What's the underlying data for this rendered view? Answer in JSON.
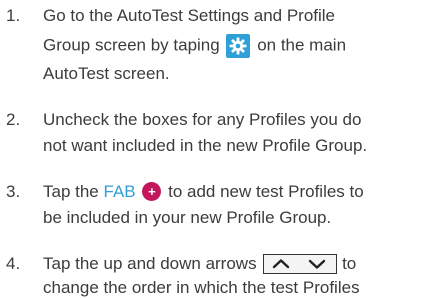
{
  "steps": [
    {
      "number": "1.",
      "lines": [
        "Go to the AutoTest Settings and Profile",
        "Group screen by taping",
        "on the main",
        "AutoTest screen."
      ]
    },
    {
      "number": "2.",
      "lines": [
        "Uncheck the boxes for any Profiles you do",
        "not want included in the new Profile Group."
      ]
    },
    {
      "number": "3.",
      "lines": [
        "Tap the",
        "FAB",
        "to add new test Profiles to",
        "be included in your new Profile Group."
      ]
    },
    {
      "number": "4.",
      "lines": [
        "Tap the up and down arrows",
        "to",
        "change the order in which the test Profiles"
      ]
    }
  ],
  "icons": {
    "settings": "gear-icon",
    "fab": "plus-circle-icon",
    "arrows": "up-down-arrows-icon"
  },
  "colors": {
    "text": "#3c3c3c",
    "link": "#2f9fd8",
    "gear_bg": "#2f9fd8",
    "fab_bg": "#c2185b"
  }
}
